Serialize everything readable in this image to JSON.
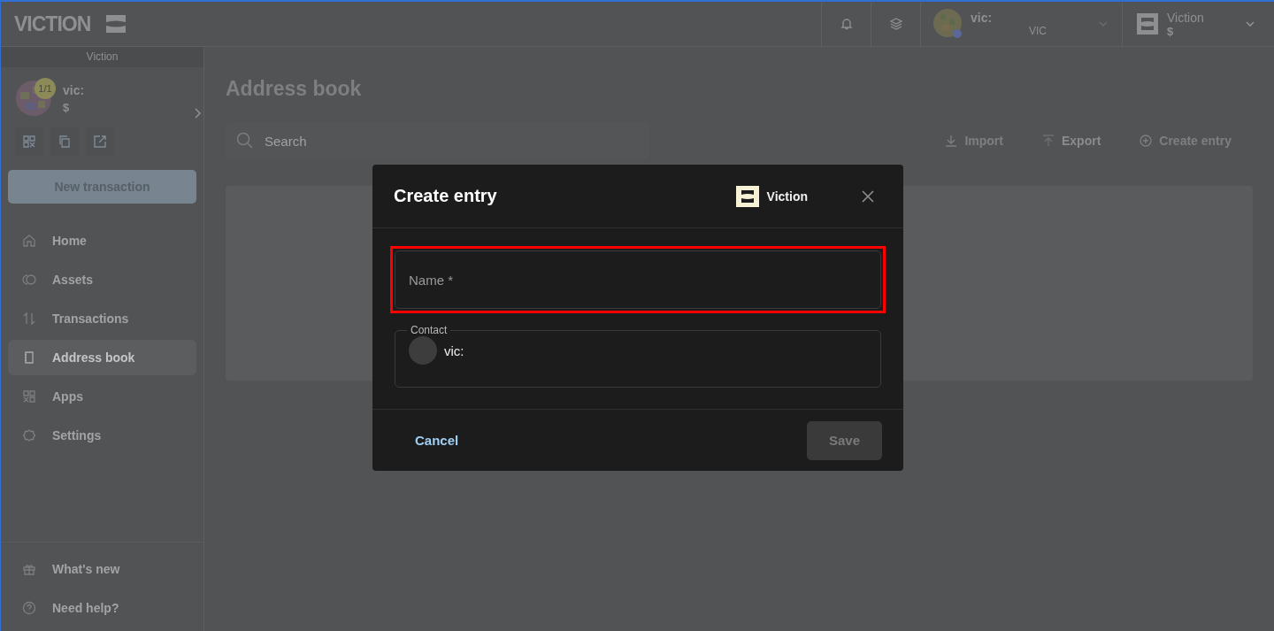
{
  "header": {
    "logo": "VICTION",
    "account": {
      "name": "vic:",
      "currency": "VIC"
    },
    "network": {
      "name": "Viction",
      "balance": "$"
    }
  },
  "sidebar": {
    "network_label": "Viction",
    "safe": {
      "badge": "1/1",
      "name": "vic:",
      "balance": "$"
    },
    "new_transaction": "New transaction",
    "items": [
      {
        "label": "Home",
        "selected": false
      },
      {
        "label": "Assets",
        "selected": false
      },
      {
        "label": "Transactions",
        "selected": false
      },
      {
        "label": "Address book",
        "selected": true
      },
      {
        "label": "Apps",
        "selected": false
      },
      {
        "label": "Settings",
        "selected": false
      }
    ],
    "footer_items": [
      {
        "label": "What's new"
      },
      {
        "label": "Need help?"
      }
    ]
  },
  "main": {
    "title": "Address book",
    "search": {
      "placeholder": "Search"
    },
    "actions": [
      {
        "label": "Import",
        "disabled": false
      },
      {
        "label": "Export",
        "disabled": true
      },
      {
        "label": "Create entry",
        "disabled": false
      }
    ]
  },
  "dialog": {
    "title": "Create entry",
    "network": "Viction",
    "name_field": {
      "placeholder": "Name *",
      "highlighted": true
    },
    "contact": {
      "label": "Contact",
      "value": "vic:"
    },
    "cancel": "Cancel",
    "save": {
      "label": "Save",
      "disabled": true
    }
  }
}
